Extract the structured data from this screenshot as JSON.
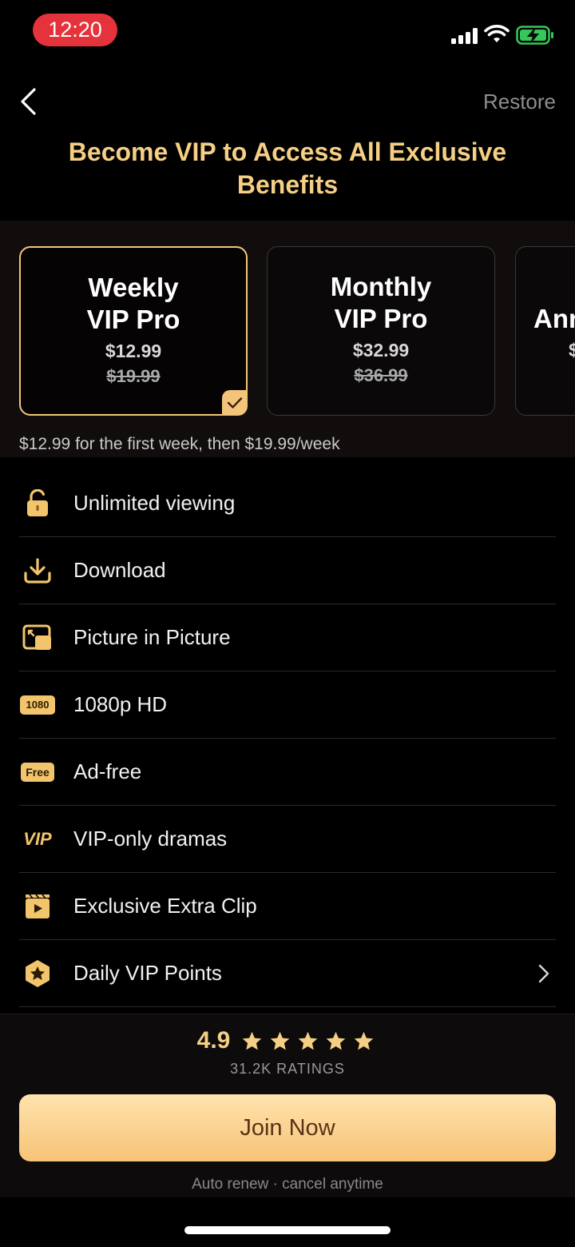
{
  "status_bar": {
    "time": "12:20",
    "accent": "#e5333b"
  },
  "nav": {
    "back_icon": "chevron-left-icon",
    "restore_label": "Restore"
  },
  "title": {
    "line1": "Become VIP to Access All Exclusive",
    "line2": "Benefits"
  },
  "plans": [
    {
      "name_line1": "Weekly",
      "name_line2": "VIP Pro",
      "price": "$12.99",
      "old_price": "$19.99",
      "selected": true
    },
    {
      "name_line1": "Monthly",
      "name_line2": "VIP Pro",
      "price": "$32.99",
      "old_price": "$36.99",
      "selected": false
    },
    {
      "name_line1": "Ann",
      "name_line2": "",
      "price": "$",
      "old_price": "",
      "selected": false
    }
  ],
  "plan_note": "$12.99 for the first week, then $19.99/week",
  "benefits": [
    {
      "icon": "unlock-icon",
      "label": "Unlimited viewing"
    },
    {
      "icon": "download-icon",
      "label": "Download"
    },
    {
      "icon": "picture-in-picture-icon",
      "label": "Picture in Picture"
    },
    {
      "icon": "hd-1080-icon",
      "label": "1080p HD",
      "icon_text": "1080"
    },
    {
      "icon": "ad-free-icon",
      "label": "Ad-free",
      "icon_text": "Free"
    },
    {
      "icon": "vip-icon",
      "label": "VIP-only dramas",
      "icon_text": "VIP"
    },
    {
      "icon": "clip-icon",
      "label": "Exclusive Extra Clip"
    },
    {
      "icon": "vip-points-icon",
      "label": "Daily VIP Points"
    }
  ],
  "rating": {
    "score": "4.9",
    "stars": 5,
    "count": "31.2K RATINGS"
  },
  "cta": {
    "join_label": "Join Now",
    "auto_renew": "Auto renew · cancel anytime"
  },
  "colors": {
    "gold": "#f5cf84",
    "gold_border": "#f3c57a",
    "button_top": "#ffe3ad",
    "button_bottom": "#f7c377"
  }
}
